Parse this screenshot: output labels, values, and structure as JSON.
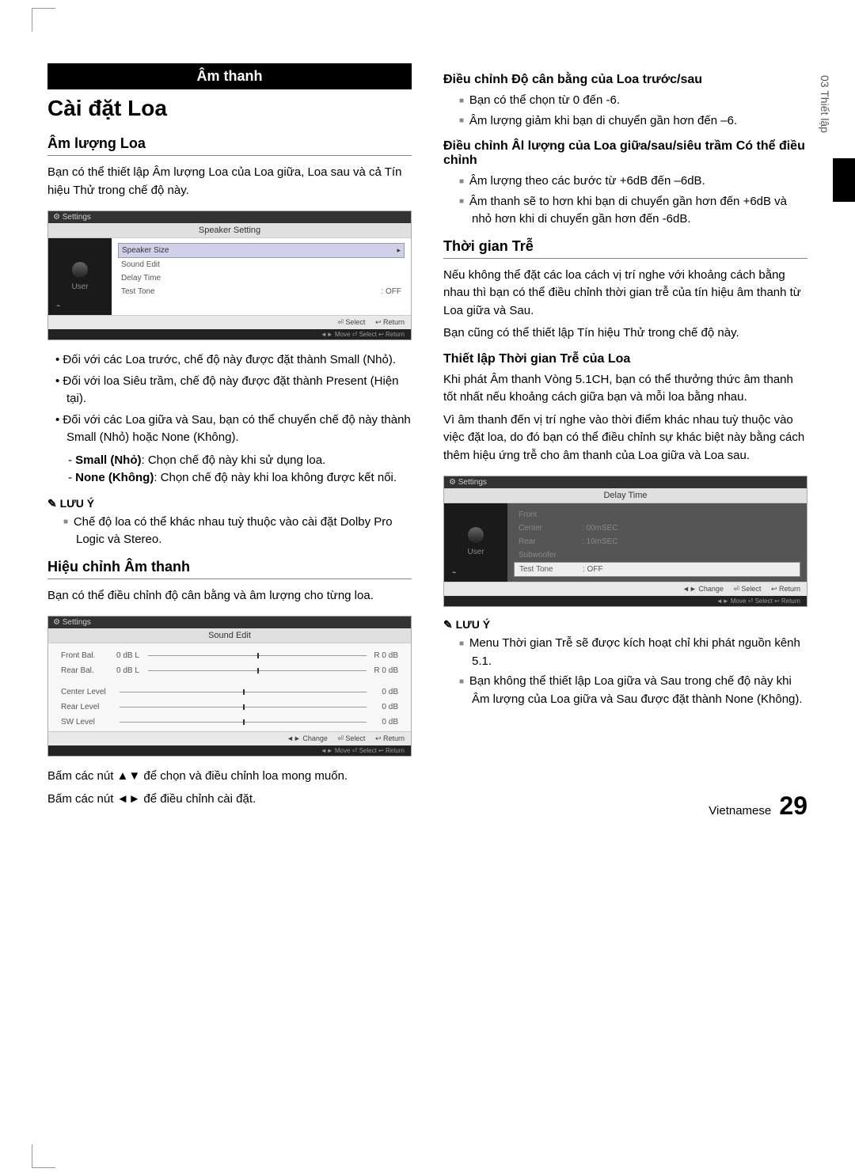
{
  "sideTab": "03  Thiết lập",
  "sectionBar": "Âm thanh",
  "mainTitle": "Cài đặt Loa",
  "leftCol": {
    "h_amLuongLoa": "Âm lượng Loa",
    "p_intro": "Bạn có thể thiết lập Âm lượng Loa của Loa giữa, Loa sau và cả Tín hiệu Thử trong chế độ này.",
    "ui1": {
      "topLabel": "Settings",
      "title": "Speaker Setting",
      "sideUser": "User",
      "rows": {
        "r1": "Speaker Size",
        "r2": "Sound Edit",
        "r3": "Delay Time",
        "r4": "Test Tone",
        "r4v": ": OFF"
      },
      "footer": {
        "select": "⏎ Select",
        "return": "↩ Return"
      },
      "darkFooter": "◄► Move    ⏎ Select    ↩ Return"
    },
    "bullets1": [
      "Đối với các Loa trước, chế độ này được đặt thành Small (Nhỏ).",
      "Đối với loa Siêu trầm, chế độ này được đặt thành Present (Hiện tại).",
      "Đối với các Loa giữa và Sau, bạn có thể chuyển chế độ này thành Small (Nhỏ) hoặc None (Không)."
    ],
    "dash1a_b": "Small (Nhỏ)",
    "dash1a_t": ": Chọn chế độ này khi sử dụng loa.",
    "dash1b_b": "None (Không)",
    "dash1b_t": ": Chọn chế độ này khi loa không được kết nối.",
    "noteLabel1": "LƯU Ý",
    "note1": "Chế độ loa có thể khác nhau tuỳ thuộc vào cài đặt Dolby Pro Logic và Stereo.",
    "h_hieuChinh": "Hiệu chỉnh Âm thanh",
    "p_hieuChinh": "Bạn có thể điều chỉnh độ cân bằng và âm lượng cho từng loa.",
    "ui2": {
      "topLabel": "Settings",
      "title": "Sound Edit",
      "rows": {
        "r1l": "Front  Bal.",
        "r1a": "0 dB  L",
        "r1b": "R 0  dB",
        "r2l": "Rear  Bal.",
        "r2a": "0 dB  L",
        "r2b": "R 0  dB",
        "r3l": "Center  Level",
        "r3v": "0  dB",
        "r4l": "Rear  Level",
        "r4v": "0  dB",
        "r5l": "SW  Level",
        "r5v": "0  dB"
      },
      "footer": {
        "change": "◄► Change",
        "select": "⏎ Select",
        "return": "↩ Return"
      },
      "darkFooter": "◄► Move    ⏎ Select    ↩ Return"
    },
    "p_arrows1": "Bấm các nút   ▲▼ để chọn và điều chỉnh loa mong muốn.",
    "p_arrows2": "Bấm các nút  ◄► để điều chỉnh cài đặt."
  },
  "rightCol": {
    "h_dieuChinhCanBang": "Điều chỉnh Độ cân bằng của Loa trước/sau",
    "sq1": [
      "Bạn có thể chọn từ 0 đến -6.",
      "Âm lượng giảm khi bạn di chuyển gần hơn đến –6."
    ],
    "h_dieuChinhAmLuong": "Điều chỉnh Âl lượng của Loa giữa/sau/siêu trầm Có thể điều chỉnh",
    "sq2": [
      "Âm lượng theo các bước từ +6dB đến –6dB.",
      "Âm thanh sẽ to hơn khi bạn di chuyển gần hơn đến +6dB và nhỏ hơn khi di chuyển gần hơn đến -6dB."
    ],
    "h_thoiGianTre": "Thời gian Trễ",
    "p_tgt1": "Nếu không thể đặt các loa cách vị trí nghe với khoảng cách bằng nhau thì bạn có thể điều chỉnh thời gian trễ của tín hiệu âm thanh từ Loa giữa và Sau.",
    "p_tgt2": "Bạn cũng có thể thiết lập Tín hiệu Thử trong chế độ này.",
    "h_thietLapTGT": "Thiết lập Thời gian Trễ của Loa",
    "p_tl1": "Khi phát Âm thanh Vòng 5.1CH, bạn có thể thưởng thức âm thanh tốt nhất nếu khoảng cách giữa bạn và mỗi loa bằng nhau.",
    "p_tl2": "Vì âm thanh đến vị trí nghe vào thời điểm khác nhau tuỳ thuộc vào việc đặt loa, do đó bạn có thể điều chỉnh sự khác biệt này bằng cách thêm hiệu ứng trễ cho âm thanh của Loa giữa và Loa sau.",
    "ui3": {
      "topLabel": "Settings",
      "title": "Delay Time",
      "sideUser": "User",
      "rows": {
        "r1": "Front",
        "r2": "Center",
        "r2v": ": 00mSEC",
        "r3": "Rear",
        "r3v": ": 10mSEC",
        "r4": "Subwoofer",
        "r5": "Test Tone",
        "r5v": ": OFF"
      },
      "footer": {
        "change": "◄► Change",
        "select": "⏎ Select",
        "return": "↩ Return"
      },
      "darkFooter": "◄► Move    ⏎ Select    ↩ Return"
    },
    "noteLabel2": "LƯU Ý",
    "sq3": [
      "Menu Thời gian Trễ sẽ được kích hoạt chỉ khi phát nguồn kênh 5.1.",
      "Bạn không thể thiết lập Loa giữa và Sau trong chế độ này khi Âm lượng của Loa giữa và Sau được đặt thành None (Không)."
    ]
  },
  "pageLang": "Vietnamese",
  "pageNum": "29"
}
